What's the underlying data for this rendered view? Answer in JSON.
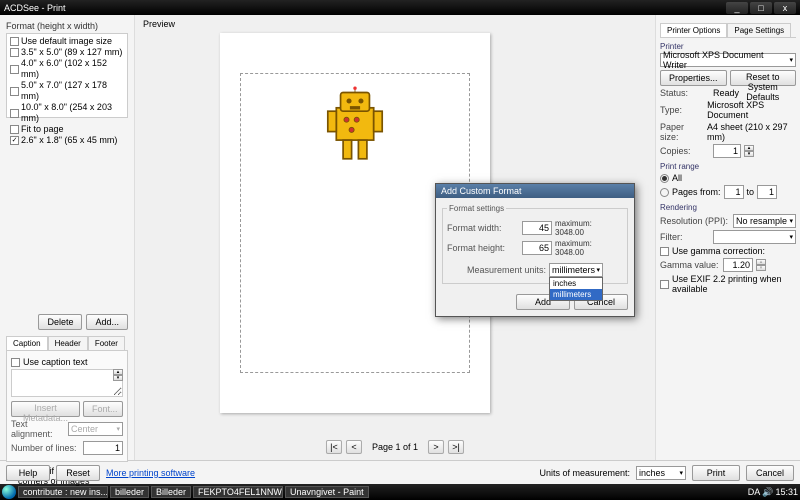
{
  "window": {
    "title": "ACDSee - Print",
    "min": "_",
    "max": "□",
    "close": "x"
  },
  "left": {
    "format_label": "Format (height x width)",
    "formats": [
      {
        "checked": false,
        "label": "Use default image size"
      },
      {
        "checked": false,
        "label": "3.5\" x 5.0\" (89 x 127 mm)"
      },
      {
        "checked": false,
        "label": "4.0\" x 6.0\" (102 x 152 mm)"
      },
      {
        "checked": false,
        "label": "5.0\" x 7.0\" (127 x 178 mm)"
      },
      {
        "checked": false,
        "label": "10.0\" x 8.0\" (254 x 203 mm)"
      },
      {
        "checked": false,
        "label": "Fit to page"
      },
      {
        "checked": true,
        "label": "2.6\" x 1.8\" (65 x 45 mm)"
      }
    ],
    "delete_btn": "Delete",
    "add_btn": "Add...",
    "tabs": [
      "Caption",
      "Header",
      "Footer"
    ],
    "use_caption": "Use caption text",
    "insert_meta": "Insert Metadata...",
    "font_btn": "Font...",
    "text_align_lbl": "Text alignment:",
    "text_align_val": "Center",
    "lines_lbl": "Number of lines:",
    "lines_val": "1",
    "exif_check": "Print Exif date in the corners of images"
  },
  "preview": {
    "label": "Preview",
    "pager": {
      "first": "|<",
      "prev": "<",
      "text": "Page 1 of 1",
      "next": ">",
      "last": ">|"
    }
  },
  "dialog": {
    "title": "Add Custom Format",
    "fieldset": "Format settings",
    "width_lbl": "Format width:",
    "width_val": "45",
    "width_max": "maximum: 3048.00",
    "height_lbl": "Format height:",
    "height_val": "65",
    "height_max": "maximum: 3048.00",
    "units_lbl": "Measurement units:",
    "units_val": "millimeters",
    "units_opts": [
      "inches",
      "millimeters"
    ],
    "add": "Add",
    "cancel": "Cancel"
  },
  "right": {
    "tabs": [
      "Printer Options",
      "Page Settings"
    ],
    "printer_lbl": "Printer",
    "printer_sel": "Microsoft XPS Document Writer",
    "props_btn": "Properties...",
    "reset_btn": "Reset to System Defaults",
    "status_lbl": "Status:",
    "status_val": "Ready",
    "type_lbl": "Type:",
    "type_val": "Microsoft XPS Document",
    "paper_lbl": "Paper size:",
    "paper_val": "A4 sheet (210 x 297 mm)",
    "copies_lbl": "Copies:",
    "copies_val": "1",
    "range_lbl": "Print range",
    "all": "All",
    "pages": "Pages from:",
    "pages_from": "1",
    "to": "to",
    "pages_to": "1",
    "render_lbl": "Rendering",
    "res_lbl": "Resolution (PPI):",
    "res_val": "No resample",
    "filter_lbl": "Filter:",
    "filter_val": "",
    "gamma_cb": "Use gamma correction:",
    "gamma_lbl": "Gamma value:",
    "gamma_val": "1.20",
    "exif22": "Use EXIF 2.2 printing when available"
  },
  "footer": {
    "help": "Help",
    "reset": "Reset",
    "link": "More printing software",
    "units_lbl": "Units of measurement:",
    "units_val": "inches",
    "print": "Print",
    "cancel": "Cancel"
  },
  "taskbar": {
    "items": [
      "contribute : new ins...",
      "billeder",
      "Billeder",
      "FEKPTO4FEL1NNW...",
      "Unavngivet - Paint"
    ],
    "lang": "DA",
    "time": "15:31"
  }
}
